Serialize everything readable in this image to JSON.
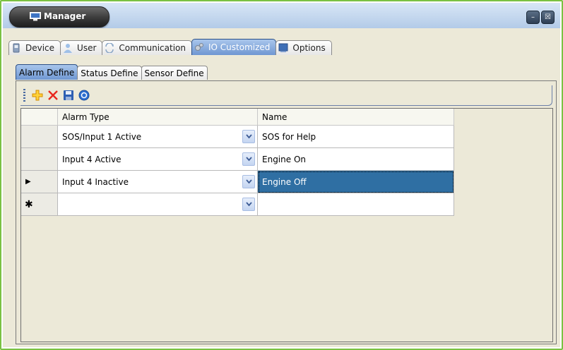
{
  "window": {
    "title": "Manager",
    "minimize_label": "–",
    "close_label": "☒"
  },
  "main_tabs": [
    {
      "label": "Device",
      "icon": "device-icon"
    },
    {
      "label": "User",
      "icon": "user-icon"
    },
    {
      "label": "Communication",
      "icon": "communication-icon"
    },
    {
      "label": "IO Customized",
      "icon": "io-icon",
      "active": true
    },
    {
      "label": "Options",
      "icon": "options-icon"
    }
  ],
  "sub_tabs": [
    {
      "label": "Alarm Define",
      "active": true
    },
    {
      "label": "Status Define"
    },
    {
      "label": "Sensor Define"
    }
  ],
  "toolbar": {
    "icons": [
      "add-icon",
      "delete-icon",
      "save-icon",
      "info-icon"
    ]
  },
  "grid": {
    "columns": [
      "Alarm Type",
      "Name"
    ],
    "rows": [
      {
        "indicator": "",
        "alarm_type": "SOS/Input 1 Active",
        "name": "SOS for Help"
      },
      {
        "indicator": "",
        "alarm_type": "Input 4 Active",
        "name": "Engine On"
      },
      {
        "indicator": "▶",
        "alarm_type": "Input 4 Inactive",
        "name": "Engine Off",
        "selected": true
      },
      {
        "indicator": "✱",
        "alarm_type": "",
        "name": ""
      }
    ]
  },
  "colors": {
    "frame_border": "#7ac142",
    "selection": "#2f6fa3",
    "active_tab": "#6f97d2"
  }
}
